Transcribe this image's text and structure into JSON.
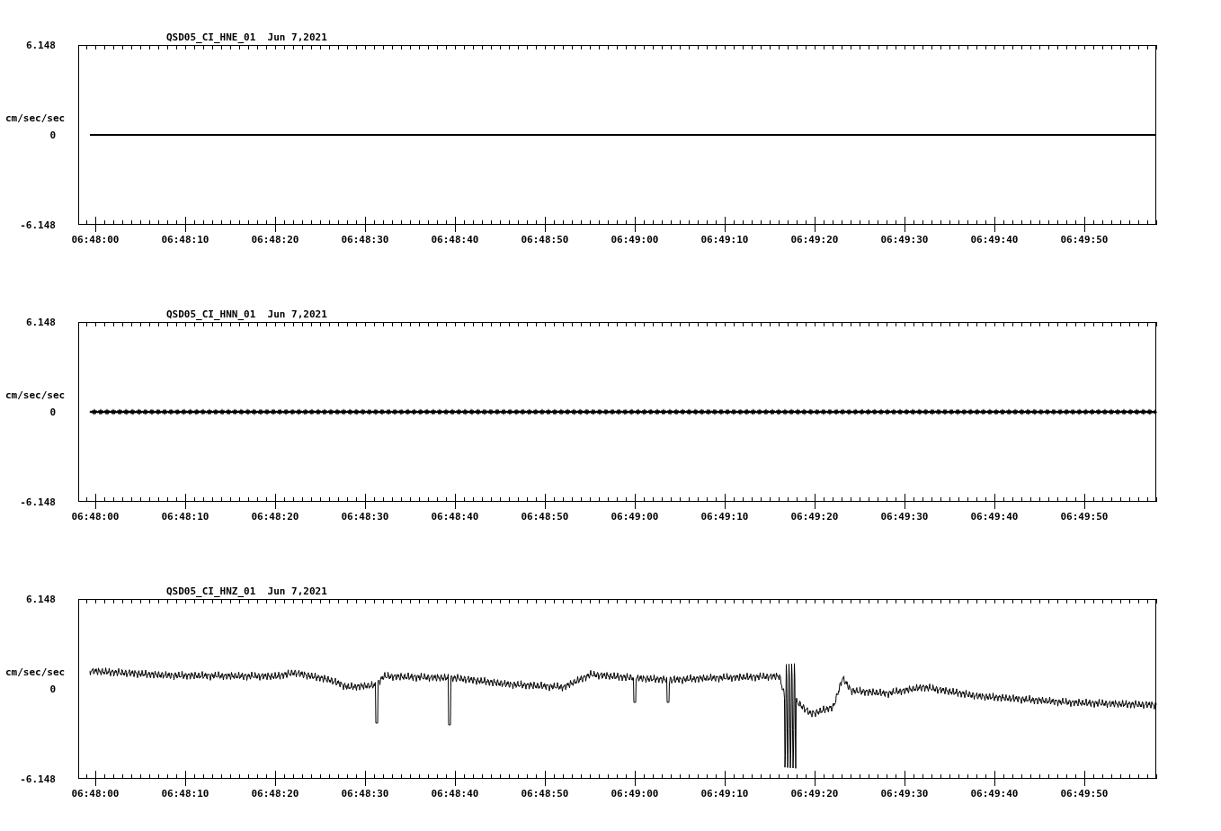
{
  "panels": [
    {
      "title": "QSD05_CI_HNE_01  Jun 7,2021",
      "ylabel": "cm/sec/sec",
      "y_ticks": [
        "6.148",
        "0",
        "-6.148"
      ],
      "kind": "flat",
      "x_ticks": [
        "06:48:00",
        "06:48:10",
        "06:48:20",
        "06:48:30",
        "06:48:40",
        "06:48:50",
        "06:49:00",
        "06:49:10",
        "06:49:20",
        "06:49:30",
        "06:49:40",
        "06:49:50"
      ]
    },
    {
      "title": "QSD05_CI_HNN_01  Jun 7,2021",
      "ylabel": "cm/sec/sec",
      "y_ticks": [
        "6.148",
        "0",
        "-6.148"
      ],
      "kind": "noisy",
      "x_ticks": [
        "06:48:00",
        "06:48:10",
        "06:48:20",
        "06:48:30",
        "06:48:40",
        "06:48:50",
        "06:49:00",
        "06:49:10",
        "06:49:20",
        "06:49:30",
        "06:49:40",
        "06:49:50"
      ]
    },
    {
      "title": "QSD05_CI_HNZ_01  Jun 7,2021",
      "ylabel": "cm/sec/sec",
      "y_ticks": [
        "6.148",
        "0",
        "-6.148"
      ],
      "kind": "event",
      "x_ticks": [
        "06:48:00",
        "06:48:10",
        "06:48:20",
        "06:48:30",
        "06:48:40",
        "06:48:50",
        "06:49:00",
        "06:49:10",
        "06:49:20",
        "06:49:30",
        "06:49:40",
        "06:49:50"
      ]
    }
  ]
}
